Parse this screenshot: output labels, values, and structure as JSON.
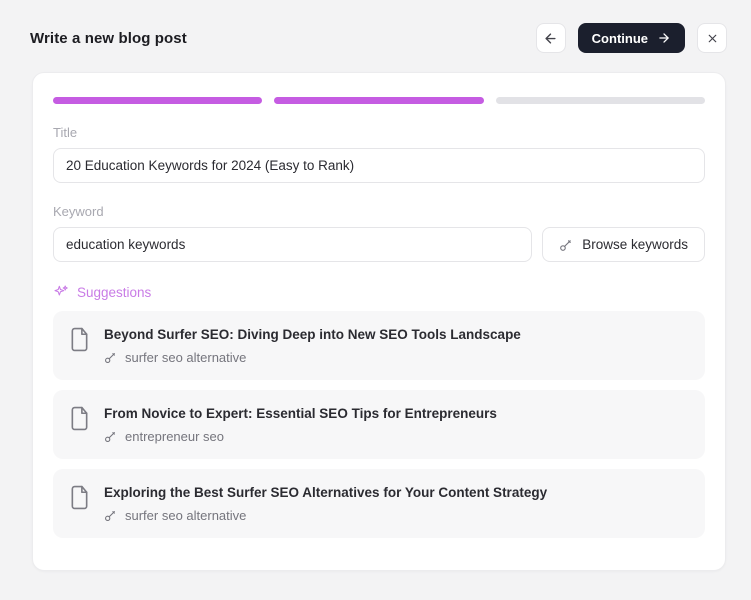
{
  "header": {
    "title": "Write a new blog post",
    "back_icon": "arrow-left",
    "continue_label": "Continue",
    "continue_icon": "arrow-right",
    "close_icon": "x"
  },
  "progress": {
    "segments": [
      {
        "state": "complete"
      },
      {
        "state": "complete"
      },
      {
        "state": "incomplete"
      }
    ]
  },
  "form": {
    "title": {
      "label": "Title",
      "value": "20 Education Keywords for 2024 (Easy to Rank)"
    },
    "keyword": {
      "label": "Keyword",
      "value": "education keywords"
    },
    "browse_button": {
      "label": "Browse keywords",
      "icon": "key-icon"
    }
  },
  "suggestions": {
    "heading": "Suggestions",
    "icon": "sparkles-icon",
    "items": [
      {
        "title": "Beyond Surfer SEO: Diving Deep into New SEO Tools Landscape",
        "keyword": "surfer seo alternative"
      },
      {
        "title": "From Novice to Expert: Essential SEO Tips for Entrepreneurs",
        "keyword": "entrepreneur seo"
      },
      {
        "title": "Exploring the Best Surfer SEO Alternatives for Your Content Strategy",
        "keyword": "surfer seo alternative"
      }
    ]
  },
  "colors": {
    "progress_fill": "#c55ce2",
    "progress_empty": "#e2e2e6",
    "suggestions_accent": "#c97ce6",
    "continue_button_bg": "#1b1f2d",
    "page_bg": "#f3f3f4",
    "card_bg": "#ffffff",
    "suggestion_card_bg": "#f7f7f8"
  }
}
